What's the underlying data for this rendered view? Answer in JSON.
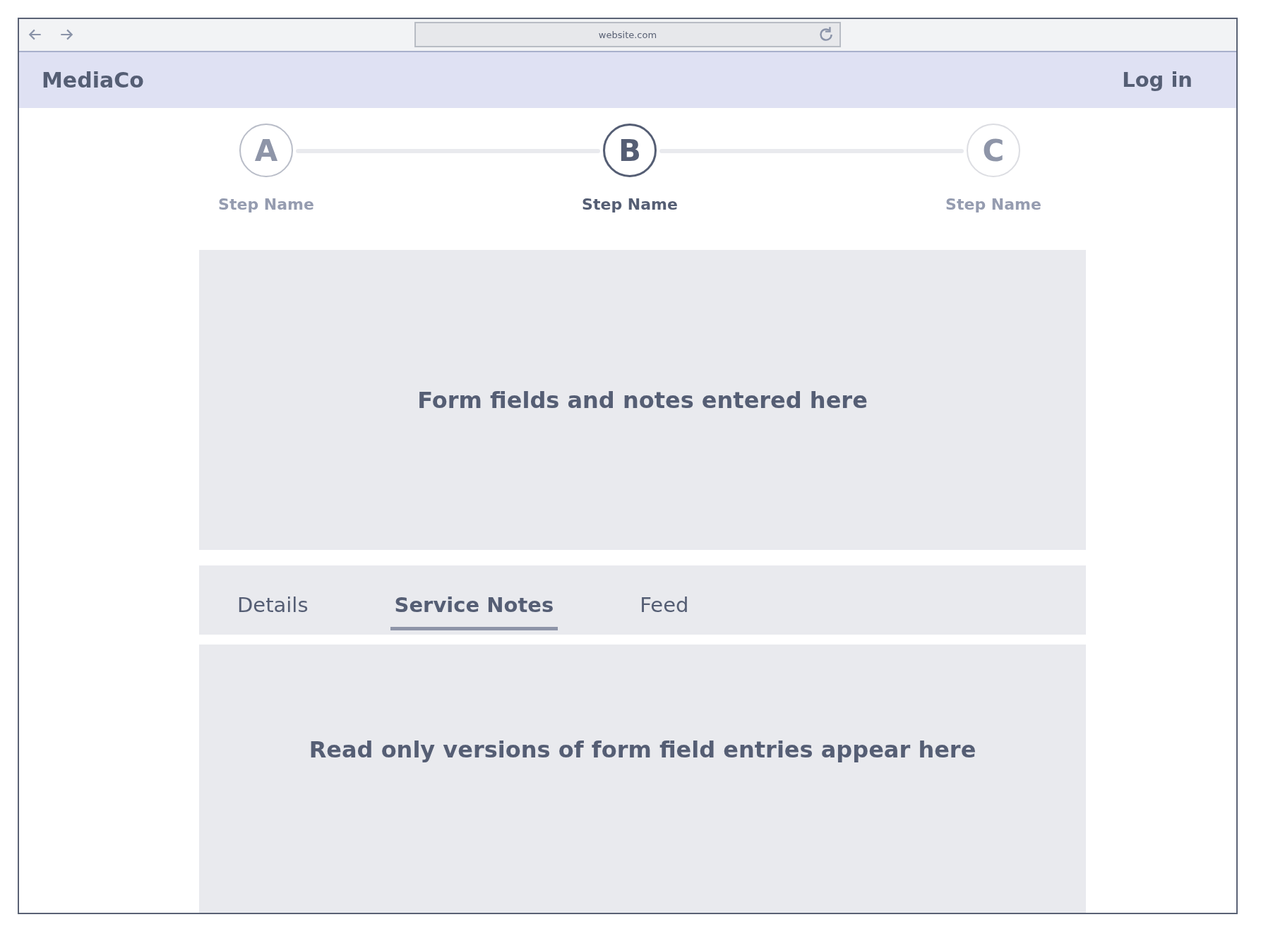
{
  "browser": {
    "url": "website.com"
  },
  "header": {
    "brand": "MediaCo",
    "login": "Log in"
  },
  "steps": [
    {
      "letter": "A",
      "label": "Step Name",
      "kind": "done",
      "selected": false
    },
    {
      "letter": "B",
      "label": "Step Name",
      "kind": "current",
      "selected": true
    },
    {
      "letter": "C",
      "label": "Step Name",
      "kind": "upcoming",
      "selected": false
    }
  ],
  "form_panel": {
    "text": "Form fields and notes entered here"
  },
  "tabs": [
    {
      "label": "Details",
      "selected": false
    },
    {
      "label": "Service Notes",
      "selected": true
    },
    {
      "label": "Feed",
      "selected": false
    }
  ],
  "readonly_panel": {
    "text": "Read only versions of form field entries appear here"
  }
}
